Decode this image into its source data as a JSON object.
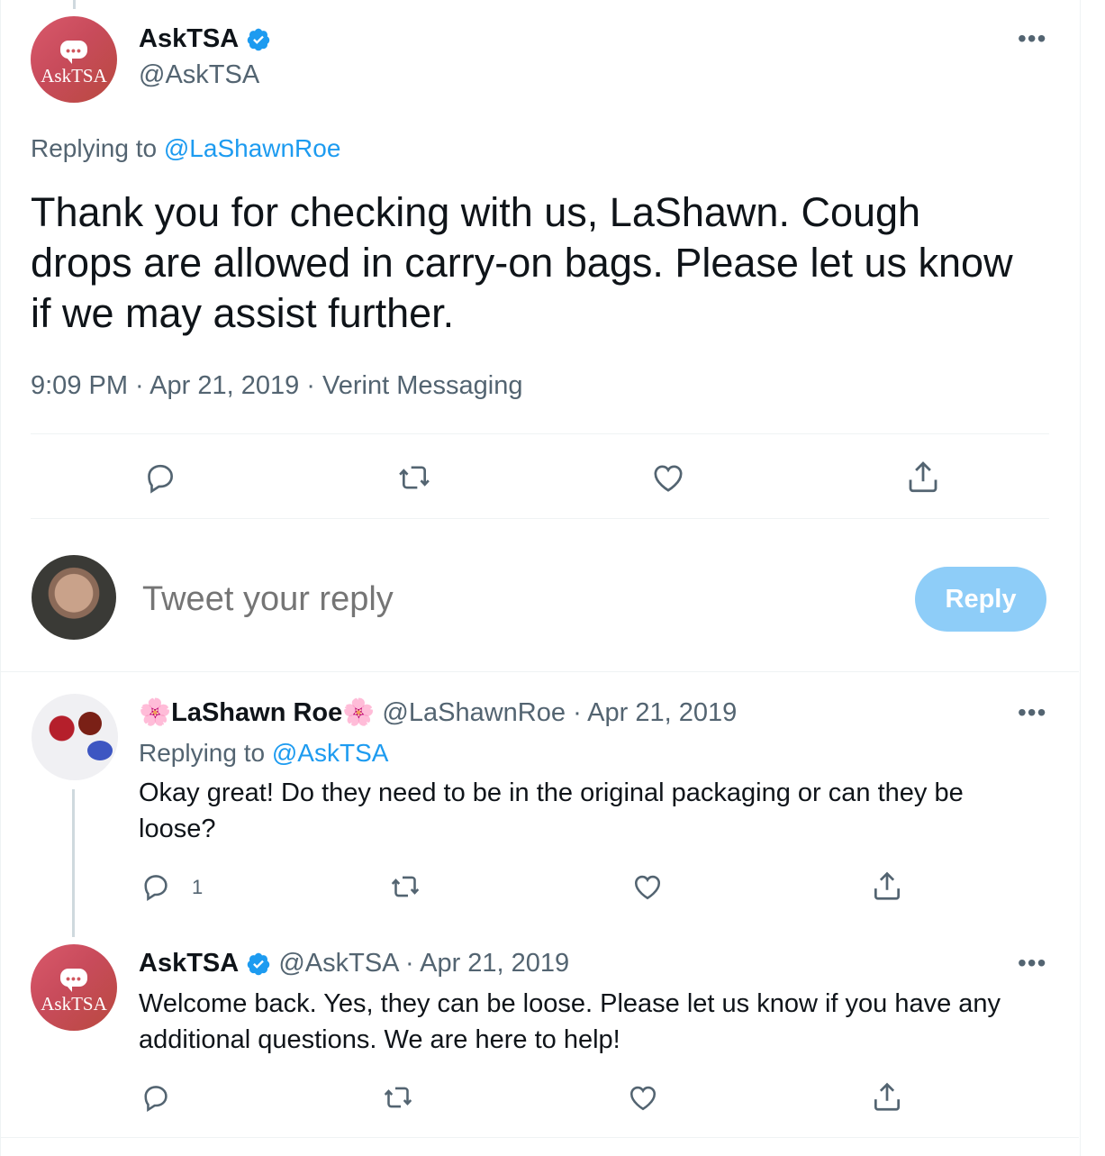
{
  "main_tweet": {
    "author_name": "AskTSA",
    "author_handle": "@AskTSA",
    "avatar_text": "AskTSA",
    "replying_prefix": "Replying to",
    "replying_to": "@LaShawnRoe",
    "text_lines": [
      "Thank you for checking with us, LaShawn. Cough",
      "drops are allowed in carry-on bags. Please let us know",
      "if we may assist further."
    ],
    "timestamp": "9:09 PM · Apr 21, 2019 · Verint Messaging"
  },
  "composer": {
    "placeholder": "Tweet your reply",
    "button_label": "Reply"
  },
  "reply_1": {
    "author_name": "🌸LaShawn Roe🌸",
    "author_handle": "@LaShawnRoe",
    "date": "· Apr 21, 2019",
    "replying_prefix": "Replying to",
    "replying_to": "@AskTSA",
    "text_lines": [
      "Okay great! Do they need to be in the original packaging or can they be",
      "loose?"
    ],
    "reply_count": "1"
  },
  "reply_2": {
    "author_name": "AskTSA",
    "author_handle": "@AskTSA",
    "date": "· Apr 21, 2019",
    "avatar_text": "AskTSA",
    "text_lines": [
      "Welcome back. Yes, they can be loose. Please let us know if you have any",
      "additional questions. We are here to help!"
    ]
  },
  "colors": {
    "link": "#1d9bf0",
    "muted": "#536471",
    "verified": "#1d9bf0",
    "reply_button": "#8ecdf8"
  },
  "icons": [
    "verified-badge-icon",
    "more-icon",
    "reply-icon",
    "retweet-icon",
    "like-icon",
    "share-icon"
  ]
}
